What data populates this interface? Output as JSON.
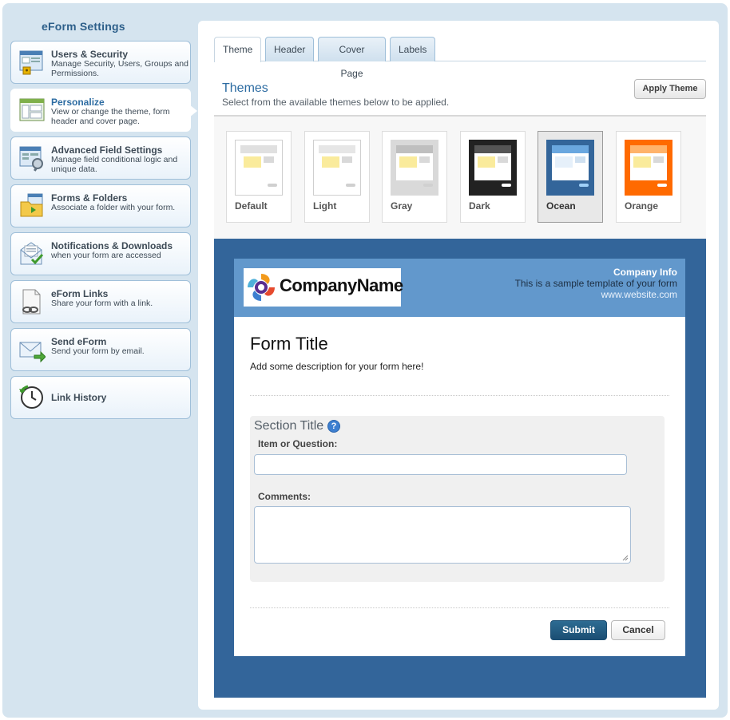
{
  "sidebar": {
    "title": "eForm Settings",
    "items": [
      {
        "label": "Users & Security",
        "desc": "Manage Security, Users, Groups and Permissions."
      },
      {
        "label": "Personalize",
        "desc": "View or change the theme, form header and cover page."
      },
      {
        "label": "Advanced Field Settings",
        "desc": "Manage field conditional logic and unique data."
      },
      {
        "label": "Forms & Folders",
        "desc": "Associate a folder with your form."
      },
      {
        "label": "Notifications & Downloads",
        "desc": "when your form are accessed"
      },
      {
        "label": "eForm Links",
        "desc": "Share your form with a link."
      },
      {
        "label": "Send eForm",
        "desc": "Send your form by email."
      },
      {
        "label": "Link History",
        "desc": ""
      }
    ],
    "active_index": 1
  },
  "tabs": [
    {
      "label": "Theme",
      "active": true
    },
    {
      "label": "Header",
      "active": false
    },
    {
      "label": "Cover Page",
      "active": false
    },
    {
      "label": "Labels",
      "active": false
    }
  ],
  "themes": {
    "heading": "Themes",
    "subtitle": "Select from the available themes below to be applied.",
    "apply_label": "Apply Theme",
    "options": [
      {
        "name": "Default",
        "bg": "#ffffff",
        "bar": "#e0e0e0",
        "panel": "#ffffff",
        "selected": false
      },
      {
        "name": "Light",
        "bg": "#ffffff",
        "bar": "#e6e6e6",
        "panel": "#ffffff",
        "selected": false
      },
      {
        "name": "Gray",
        "bg": "#d9d9d9",
        "bar": "#bfbfbf",
        "panel": "#ffffff",
        "selected": false
      },
      {
        "name": "Dark",
        "bg": "#222222",
        "bar": "#555555",
        "panel": "#ffffff",
        "selected": false
      },
      {
        "name": "Ocean",
        "bg": "#33659a",
        "bar": "#6aa7df",
        "panel": "#ffffff",
        "selected": true
      },
      {
        "name": "Orange",
        "bg": "#ff6a00",
        "bar": "#ffb36b",
        "panel": "#ffffff",
        "selected": false
      }
    ]
  },
  "preview": {
    "company_name": "CompanyName",
    "company_info_title": "Company Info",
    "company_info_line": "This is a sample template of your form",
    "company_info_web": "www.website.com",
    "form_title": "Form Title",
    "form_desc": "Add some description for your form here!",
    "section_title": "Section Title",
    "help_glyph": "?",
    "field1_label": "Item or Question:",
    "field2_label": "Comments:",
    "submit_label": "Submit",
    "cancel_label": "Cancel"
  },
  "colors": {
    "accent": "#2d6ca2",
    "ocean": "#33659a",
    "header_blue": "#6298cc",
    "submit": "#1b4e73"
  }
}
